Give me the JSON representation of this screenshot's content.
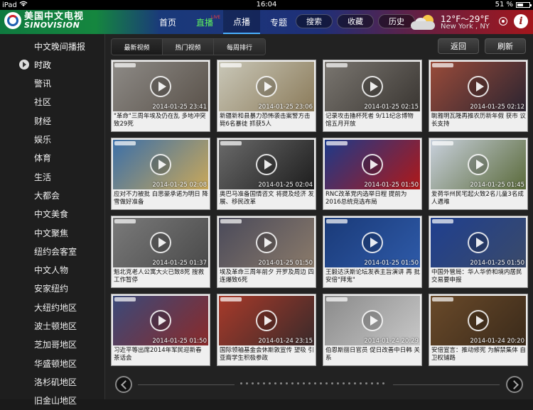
{
  "status_bar": {
    "device": "iPad",
    "time": "16:04",
    "battery_text": "51 %",
    "battery_level": 0.51
  },
  "app": {
    "logo_cn": "美国中文电视",
    "logo_en": "SINOVISION",
    "nav": [
      {
        "label": "首页",
        "active": false,
        "live": false
      },
      {
        "label": "直播",
        "active": false,
        "live": true,
        "badge": "LIVE"
      },
      {
        "label": "点播",
        "active": true,
        "live": false
      },
      {
        "label": "专题",
        "active": false,
        "live": false
      }
    ],
    "actions": [
      "搜索",
      "收藏",
      "历史"
    ],
    "weather": {
      "temp": "12°F～29°F",
      "city": "New York , NY"
    }
  },
  "sidebar": {
    "items": [
      {
        "label": "中文晚间播报",
        "active": false
      },
      {
        "label": "时政",
        "active": true
      },
      {
        "label": "警讯",
        "active": false
      },
      {
        "label": "社区",
        "active": false
      },
      {
        "label": "财经",
        "active": false
      },
      {
        "label": "娱乐",
        "active": false
      },
      {
        "label": "体育",
        "active": false
      },
      {
        "label": "生活",
        "active": false
      },
      {
        "label": "大都会",
        "active": false
      },
      {
        "label": "中文美食",
        "active": false
      },
      {
        "label": "中文聚焦",
        "active": false
      },
      {
        "label": "纽约会客室",
        "active": false
      },
      {
        "label": "中文人物",
        "active": false
      },
      {
        "label": "安家纽约",
        "active": false
      },
      {
        "label": "大纽约地区",
        "active": false
      },
      {
        "label": "波士顿地区",
        "active": false
      },
      {
        "label": "芝加哥地区",
        "active": false
      },
      {
        "label": "华盛顿地区",
        "active": false
      },
      {
        "label": "洛杉矶地区",
        "active": false
      },
      {
        "label": "旧金山地区",
        "active": false
      }
    ]
  },
  "main": {
    "tabs": [
      {
        "label": "最新视频",
        "active": true
      },
      {
        "label": "热门视频",
        "active": false
      },
      {
        "label": "每周排行",
        "active": false
      }
    ],
    "back_label": "返回",
    "refresh_label": "刷新",
    "videos": [
      {
        "caption": "\"革命\"三周年埃及仍在乱 多地冲突 致29死",
        "stamp": "2014-01-25 23:41",
        "colors": [
          "#8d8a86",
          "#5a524a"
        ]
      },
      {
        "caption": "新疆新和县暴力恐怖袭击案警方击 毙6名暴徒 抓获5人",
        "stamp": "2014-01-25 23:06",
        "colors": [
          "#c9c7b8",
          "#8b7b5a"
        ]
      },
      {
        "caption": "记录攻击播杯死者 9/11纪念博物 馆五月开放",
        "stamp": "2014-01-25 02:15",
        "colors": [
          "#7a7670",
          "#3a3632"
        ]
      },
      {
        "caption": "眺雅明瓦隆再推农历新年假 获市 议长支持",
        "stamp": "2014-01-25 02:12",
        "colors": [
          "#9a4b3a",
          "#2b2430"
        ]
      },
      {
        "caption": "应对不力被批 白思豪承诺为明日 降雪做好准备",
        "stamp": "2014-01-25 02:08",
        "colors": [
          "#3b6fa8",
          "#c9a85a"
        ]
      },
      {
        "caption": "奥巴马准备国情咨文 将提及经济 发展、移民改革",
        "stamp": "2014-01-25 02:04",
        "colors": [
          "#6a6a6a",
          "#1d1d1d"
        ]
      },
      {
        "caption": "RNC改革党内选举日程 提前为 2016总统竞选布局",
        "stamp": "2014-01-25 01:50",
        "colors": [
          "#1c3a8a",
          "#b01818"
        ]
      },
      {
        "caption": "爱荷华州民宅起火致2名儿童3名成 人遇难",
        "stamp": "2014-01-25 01:45",
        "colors": [
          "#c8d0dc",
          "#5a6a3a"
        ]
      },
      {
        "caption": "魁北克老人公寓大火已致8死 搜救 工作暂停",
        "stamp": "2014-01-25 01:37",
        "colors": [
          "#7a7a7a",
          "#4a4a4a"
        ]
      },
      {
        "caption": "埃及革命三周年前夕 开罗及周边 四连爆致6死",
        "stamp": "2014-01-25 01:50",
        "colors": [
          "#4a4a5a",
          "#8a7a6a"
        ]
      },
      {
        "caption": "王毅达沃斯论坛发表主旨演讲 再 批安倍\"拜鬼\"",
        "stamp": "2014-01-25 01:50",
        "colors": [
          "#1a3a78",
          "#2e5aa8"
        ]
      },
      {
        "caption": "中国外管局：华人华侨和境内居民 交易要申报",
        "stamp": "2014-01-25 01:50",
        "colors": [
          "#1f3f8f",
          "#3a4a6a"
        ]
      },
      {
        "caption": "习近平等出席2014年军民迎新春 茶话会",
        "stamp": "2014-01-25 01:50",
        "colors": [
          "#3a4a7a",
          "#8a2a2a"
        ]
      },
      {
        "caption": "国际领袖基金会休斯敦宣传 望吸 引亚裔学生积极参政",
        "stamp": "2014-01-24 23:15",
        "colors": [
          "#a83a2a",
          "#3a2a2a"
        ]
      },
      {
        "caption": "伯恩斯丽日官员 促日改善中日韩 关系",
        "stamp": "2014-01-24 20:29",
        "colors": [
          "#8a8a8a",
          "#c8c8c8"
        ]
      },
      {
        "caption": "安倍宣言：推动修宪 为解禁集体 自卫权铺路",
        "stamp": "2014-01-24 20:20",
        "colors": [
          "#6a4a2a",
          "#3a2a1a"
        ]
      }
    ]
  },
  "pager": {
    "page_count": 26
  }
}
